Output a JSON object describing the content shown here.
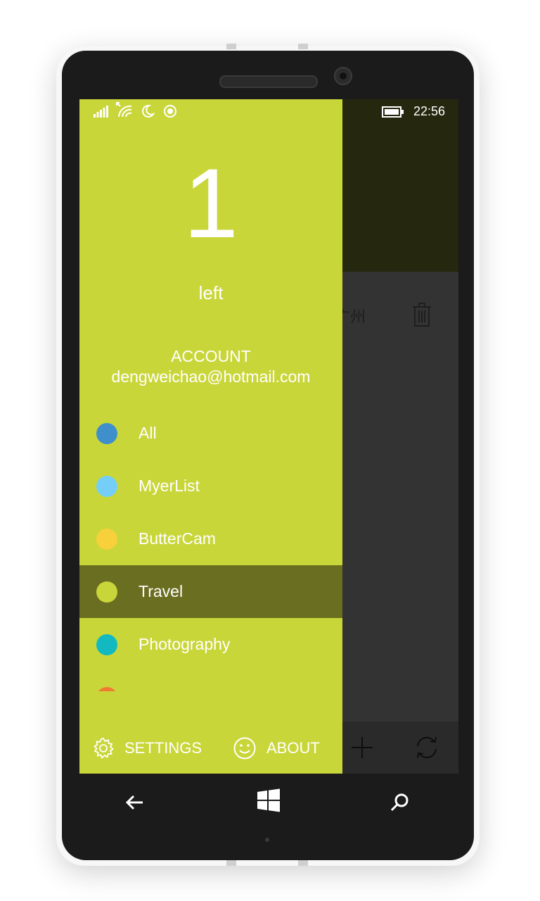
{
  "status_bar": {
    "time": "22:56",
    "icons": [
      "signal-icon",
      "wifi-icon",
      "quiet-hours-icon",
      "location-icon",
      "battery-icon"
    ]
  },
  "drawer": {
    "count": "1",
    "count_label": "left",
    "account_title": "ACCOUNT",
    "account_email": "dengweichao@hotmail.com",
    "categories": [
      {
        "label": "All",
        "color": "#3f8fcb"
      },
      {
        "label": "MyerList",
        "color": "#74cef8"
      },
      {
        "label": "ButterCam",
        "color": "#f7d03c"
      },
      {
        "label": "Travel",
        "color": "#c9d63a",
        "selected": true
      },
      {
        "label": "Photography",
        "color": "#13b9c0"
      }
    ],
    "partial_item_color": "#f07a32",
    "bottom": {
      "settings_label": "SETTINGS",
      "about_label": "ABOUT"
    }
  },
  "background_page": {
    "item_text": "-广州",
    "appbar_icons": [
      "add-icon",
      "sync-icon"
    ]
  },
  "nav_bar": {
    "icons": [
      "back-icon",
      "windows-start-icon",
      "search-icon"
    ]
  },
  "colors": {
    "accent": "#c9d63a",
    "selected": "#6a6e20",
    "header_dark": "#25270e",
    "page_bg": "#333333"
  }
}
